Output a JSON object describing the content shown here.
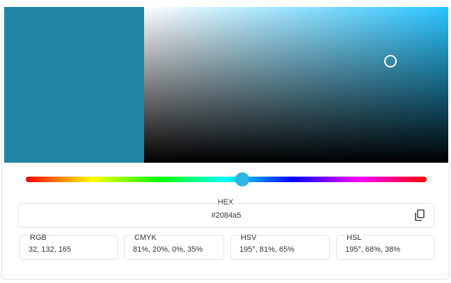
{
  "color": {
    "hex": "#2084a5",
    "hue_color": "#2ab7e6",
    "picker_hue_max": "#29c5ff",
    "saturation_percent": 81,
    "value_percent": 65,
    "hue_fraction": 0.54
  },
  "hex_field": {
    "label": "HEX",
    "value": "#2084a5",
    "copy_icon": "copy-icon"
  },
  "formats": [
    {
      "label": "RGB",
      "value": "32, 132, 165"
    },
    {
      "label": "CMYK",
      "value": "81%, 20%, 0%, 35%"
    },
    {
      "label": "HSV",
      "value": "195°, 81%, 65%"
    },
    {
      "label": "HSL",
      "value": "195°, 68%, 38%"
    }
  ]
}
